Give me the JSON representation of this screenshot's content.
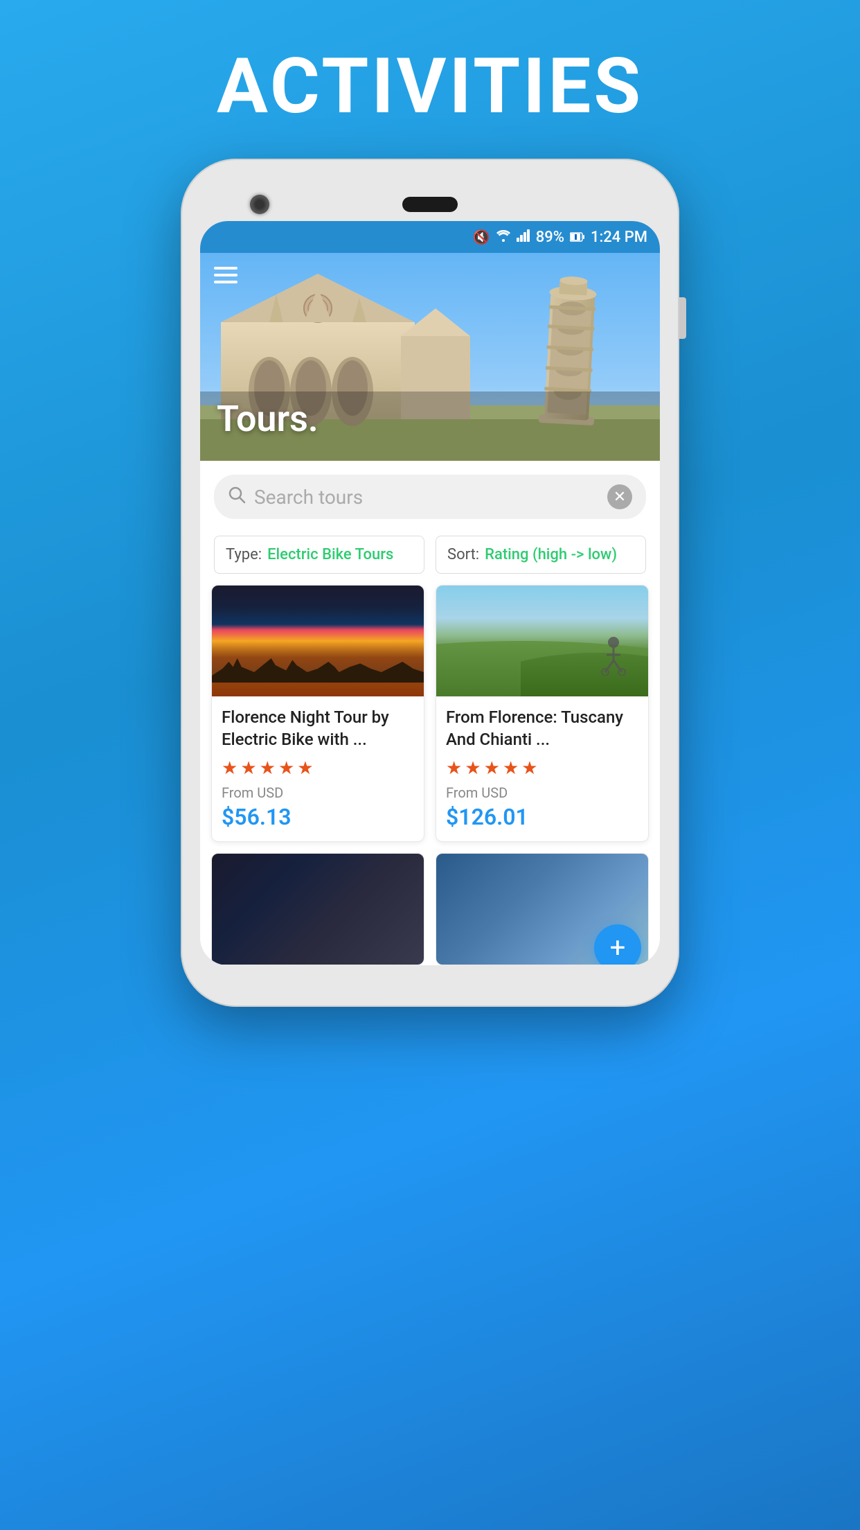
{
  "page": {
    "title": "ACTIVITIES"
  },
  "status_bar": {
    "mute_icon": "🔇",
    "wifi_icon": "WiFi",
    "signal_icon": "Signal",
    "battery": "89%",
    "time": "1:24 PM"
  },
  "hero": {
    "menu_icon": "☰",
    "title": "Tours."
  },
  "search": {
    "placeholder": "Search tours",
    "clear_icon": "✕"
  },
  "filters": {
    "type_label": "Type:",
    "type_value": "Electric Bike Tours",
    "sort_label": "Sort:",
    "sort_value": "Rating (high -> low)"
  },
  "tours": [
    {
      "title": "Florence Night Tour by Electric Bike with ...",
      "stars": 5,
      "from_label": "From USD",
      "price": "$56.13"
    },
    {
      "title": "From Florence: Tuscany And Chianti ...",
      "stars": 5,
      "from_label": "From USD",
      "price": "$126.01"
    },
    {
      "title": "",
      "stars": 0,
      "from_label": "",
      "price": ""
    },
    {
      "title": "",
      "stars": 0,
      "from_label": "",
      "price": ""
    }
  ],
  "fab": {
    "icon": "+"
  }
}
